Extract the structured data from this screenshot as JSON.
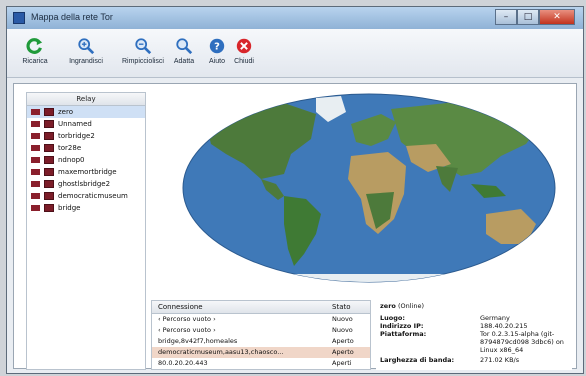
{
  "window": {
    "title": "Mappa della rete Tor",
    "min": "–",
    "max": "□",
    "close": "✕"
  },
  "toolbar": {
    "items": [
      {
        "label": "Ricarica",
        "icon": "refresh-icon"
      },
      {
        "label": "Ingrandisci",
        "icon": "zoom-in-icon"
      },
      {
        "label": "Rimpicciolisci",
        "icon": "zoom-out-icon"
      },
      {
        "label": "Adatta",
        "icon": "zoom-fit-icon"
      },
      {
        "label": "Aiuto",
        "icon": "help-icon"
      },
      {
        "label": "Chiudi",
        "icon": "close-icon"
      }
    ],
    "colors": {
      "refresh": "#1f9a3a",
      "zoom": "#2f6fbf",
      "help": "#2f6fbf",
      "close": "#d8262b"
    }
  },
  "relay": {
    "header": "Relay",
    "items": [
      "zero",
      "Unnamed",
      "torbridge2",
      "tor28e",
      "ndnop0",
      "maxemortbridge",
      "ghostlsbridge2",
      "democraticmuseum",
      "bridge"
    ],
    "selected_index": 0
  },
  "connections": {
    "col_connection": "Connessione",
    "col_state": "Stato",
    "rows": [
      {
        "name": "‹ Percorso vuoto ›",
        "state": "Nuovo"
      },
      {
        "name": "‹ Percorso vuoto ›",
        "state": "Nuovo"
      },
      {
        "name": "bridge,8v42f7,homeales",
        "state": "Aperto"
      },
      {
        "name": "democraticmuseum,aasu13,chaosco...",
        "state": "Aperto"
      },
      {
        "name": "80.0.20.20.443",
        "state": "Aperti"
      }
    ]
  },
  "details": {
    "header_name": "zero",
    "header_status": "(Online)",
    "rows": [
      {
        "label": "Luogo:",
        "value": "Germany"
      },
      {
        "label": "Indirizzo IP:",
        "value": "188.40.20.215"
      },
      {
        "label": "Piattaforma:",
        "value": "Tor 0.2.3.15-alpha (git-8794879cd098 3dbc6) on Linux x86_64"
      },
      {
        "label": "Larghezza di banda:",
        "value": "271.02 KB/s"
      }
    ]
  },
  "map": {
    "ocean": "#3f79b8",
    "land": "#4d7a3b",
    "desert": "#b89c62",
    "ice": "#e8eef2"
  }
}
